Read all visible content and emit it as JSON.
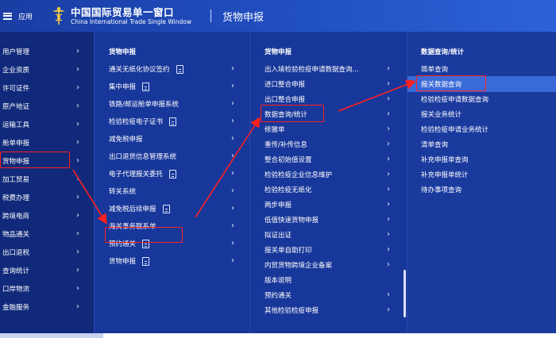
{
  "header": {
    "menu_label": "应用",
    "brand_cn": "中国国际贸易单一窗口",
    "brand_en": "China International Trade Single Window",
    "section_title": "货物申报"
  },
  "icons": {
    "menu": "hamburger-icon",
    "logo": "caduceus-logo-icon",
    "chevron": "chevron-right-icon",
    "document": "document-icon"
  },
  "colors": {
    "header_bg": "#2150c4",
    "sidebar_bg": "#10297a",
    "panel_bg": "#18379a",
    "highlight": "#2f5fd2",
    "annotation": "#ff2020"
  },
  "col1": {
    "items": [
      "用户管理",
      "企业资质",
      "许可证件",
      "原产地证",
      "运输工具",
      "舱单申报",
      "货物申报",
      "加工贸易",
      "税费办理",
      "跨境电商",
      "物品通关",
      "出口退税",
      "查询统计",
      "口岸物流",
      "金融服务"
    ]
  },
  "col2": {
    "title": "货物申报",
    "items": [
      "通关无纸化协议签约",
      "集中申报",
      "铁路/邮运舱单申报系统",
      "检验检疫电子证书",
      "减免税申报",
      "出口退货信息管理系统",
      "电子代理报关委托",
      "转关系统",
      "减免税后续申报",
      "海关事务联系单",
      "预约通关",
      "货物申报"
    ]
  },
  "col3": {
    "title": "货物申报",
    "items": [
      "出入境检验检疫申请数据查询...",
      "进口整合申报",
      "出口整合申报",
      "数据查询/统计",
      "修撤单",
      "重传/补传信息",
      "整合初始值设置",
      "检验检疫企业信息维护",
      "检验检疫无纸化",
      "两步申报",
      "低值快速货物申报",
      "拟证出证",
      "报关单自助打印",
      "内贸货物跨境企业备案",
      "版本说明",
      "预约通关",
      "其他检验检疫申报"
    ]
  },
  "col4": {
    "title": "数据查询/统计",
    "items": [
      "简单查询",
      "报关数据查询",
      "检验检疫申请数据查询",
      "报关业务统计",
      "检验检疫申请业务统计",
      "清单查询",
      "补充申报单查询",
      "补充申报单统计",
      "待办事项查询"
    ]
  }
}
